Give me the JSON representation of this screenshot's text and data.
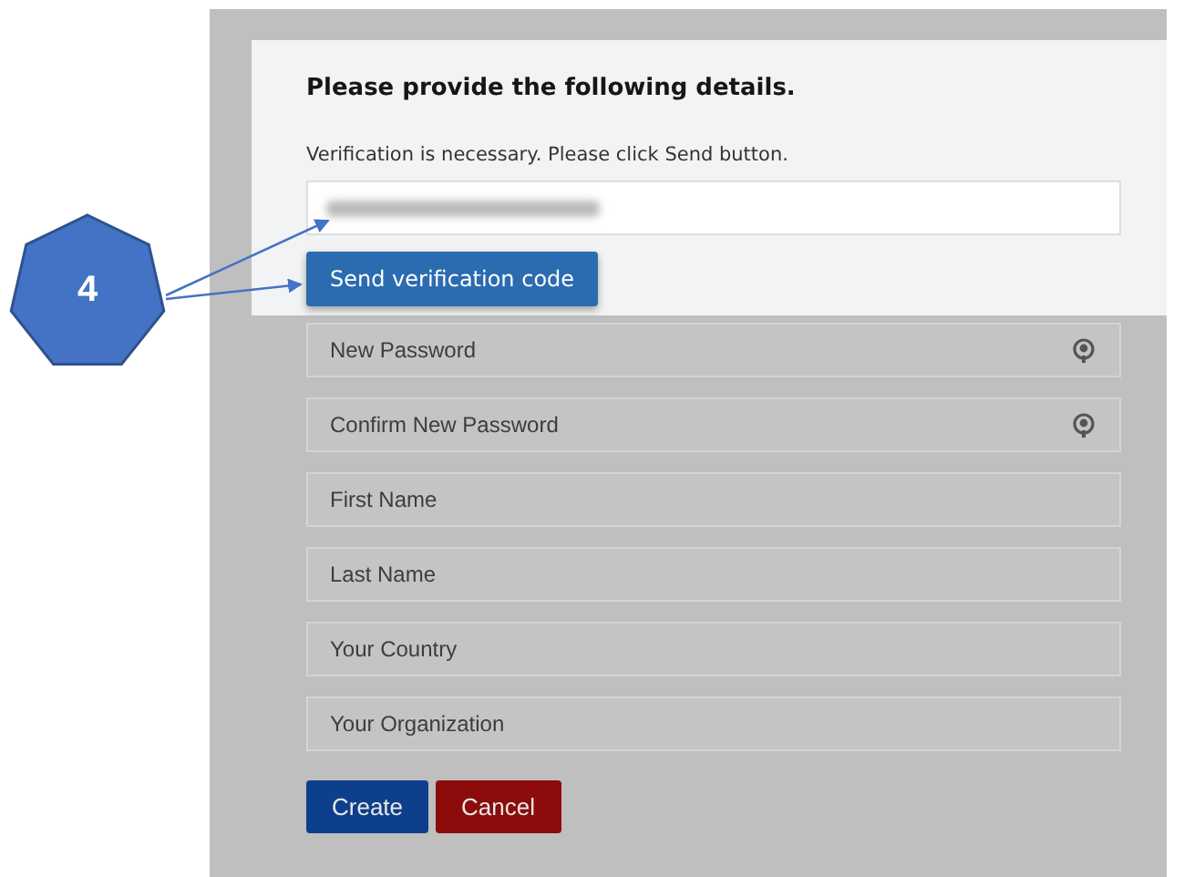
{
  "callout": {
    "label": "4"
  },
  "form": {
    "title": "Please provide the following details.",
    "instruction": "Verification is necessary. Please click Send button.",
    "email_field": {
      "blurred": true
    },
    "send_button": "Send verification code",
    "fields": [
      {
        "placeholder": "New Password",
        "kind": "password"
      },
      {
        "placeholder": "Confirm New Password",
        "kind": "password"
      },
      {
        "placeholder": "First Name",
        "kind": "text"
      },
      {
        "placeholder": "Last Name",
        "kind": "text"
      },
      {
        "placeholder": "Your Country",
        "kind": "text"
      },
      {
        "placeholder": "Your Organization",
        "kind": "text"
      }
    ],
    "buttons": [
      {
        "label": "Create",
        "kind": "primary"
      },
      {
        "label": "Cancel",
        "kind": "danger"
      }
    ]
  }
}
